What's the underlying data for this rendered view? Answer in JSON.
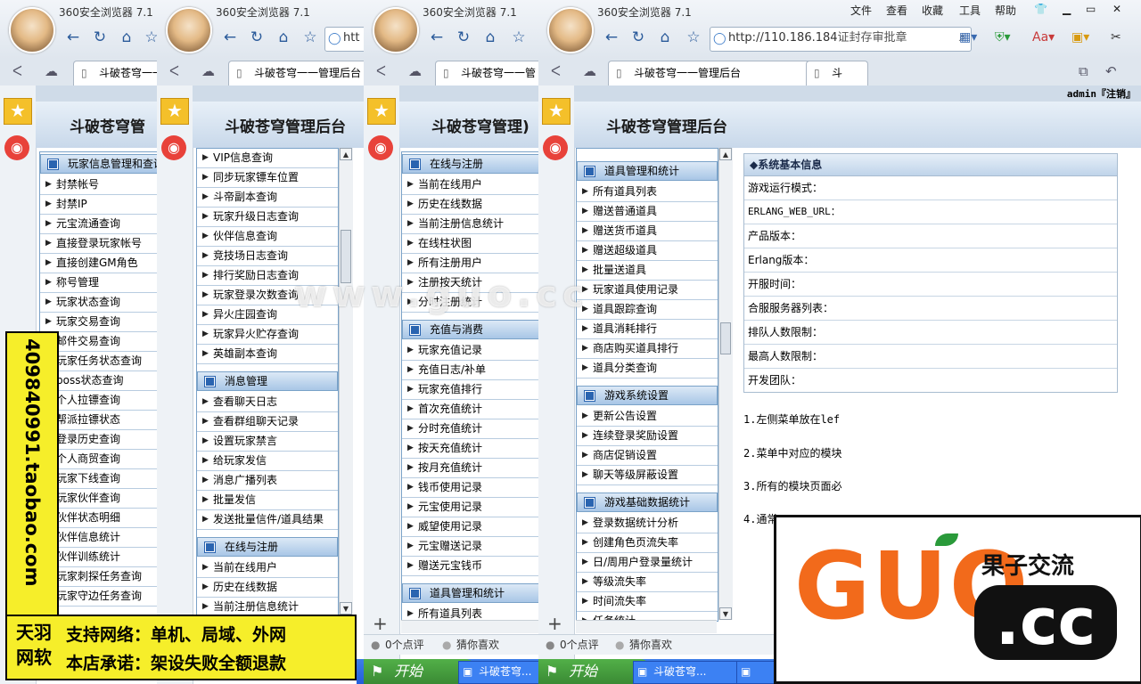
{
  "browser": {
    "title": "360安全浏览器 7.1",
    "url_partial_1": "htt",
    "url_full": "http://110.186.184",
    "url_extra": "证封存审批章",
    "tab_label_short": "斗破苍穹一一",
    "tab_label_mid": "斗破苍穹一一管理后台",
    "tab_label_full": "斗破苍穹一一管理后台",
    "tab_label_cut": "斗破苍穹一一管",
    "tab_next": "斗",
    "menubar": [
      "文件",
      "查看",
      "收藏",
      "工具",
      "帮助"
    ],
    "status_comments": "0个点评",
    "status_guess": "猜你喜欢",
    "close_x": "×",
    "new_tab_plus": "+"
  },
  "page": {
    "admin_bar": "admin『注销』",
    "banner_title": "斗破苍穹管理后台",
    "banner_title_cut1": "斗破苍穹管",
    "banner_title_cut2": "斗破苍穹管理后台",
    "banner_title_cut3": "斗破苍穹管理)"
  },
  "menu_win1": {
    "head": "玩家信息管理和查询",
    "items": [
      "封禁帐号",
      "封禁IP",
      "元宝流通查询",
      "直接登录玩家帐号",
      "直接创建GM角色",
      "称号管理",
      "玩家状态查询",
      "玩家交易查询",
      "邮件交易查询",
      "玩家任务状态查询",
      "boss状态查询",
      "个人拉镖查询",
      "帮派拉镖状态",
      "登录历史查询",
      "个人商贸查询",
      "玩家下线查询",
      "玩家伙伴查询",
      "伙伴状态明细",
      "伙伴信息统计",
      "伙伴训练统计",
      "玩家刺探任务查询",
      "玩家守边任务查询"
    ]
  },
  "menu_win2": {
    "items_top": [
      "VIP信息查询",
      "同步玩家镖车位置",
      "斗帝副本查询",
      "玩家升级日志查询",
      "伙伴信息查询",
      "竞技场日志查询",
      "排行奖励日志查询",
      "玩家登录次数查询",
      "异火庄园查询",
      "玩家异火贮存查询",
      "英雄副本查询"
    ],
    "head_msg": "消息管理",
    "items_msg": [
      "查看聊天日志",
      "查看群组聊天记录",
      "设置玩家禁言",
      "给玩家发信",
      "消息广播列表",
      "批量发信",
      "发送批量信件/道具结果"
    ],
    "head_online": "在线与注册",
    "items_online": [
      "当前在线用户",
      "历史在线数据",
      "当前注册信息统计"
    ]
  },
  "menu_win3": {
    "head_online": "在线与注册",
    "items_online": [
      "当前在线用户",
      "历史在线数据",
      "当前注册信息统计",
      "在线柱状图",
      "所有注册用户",
      "注册按天统计",
      "分时注册统计"
    ],
    "head_pay": "充值与消费",
    "items_pay": [
      "玩家充值记录",
      "充值日志/补单",
      "玩家充值排行",
      "首次充值统计",
      "分时充值统计",
      "按天充值统计",
      "按月充值统计",
      "钱币使用记录",
      "元宝使用记录",
      "威望使用记录",
      "元宝赠送记录",
      "赠送元宝钱币"
    ],
    "head_items": "道具管理和统计",
    "items_items": [
      "所有道具列表"
    ]
  },
  "menu_win4": {
    "head_items": "道具管理和统计",
    "items_items": [
      "所有道具列表",
      "赠送普通道具",
      "赠送货币道具",
      "赠送超级道具",
      "批量送道具",
      "玩家道具使用记录",
      "道具跟踪查询",
      "道具消耗排行",
      "商店购买道具排行",
      "道具分类查询"
    ],
    "head_sys": "游戏系统设置",
    "items_sys": [
      "更新公告设置",
      "连续登录奖励设置",
      "商店促销设置",
      "聊天等级屏蔽设置"
    ],
    "head_stats": "游戏基础数据统计",
    "items_stats": [
      "登录数据统计分析",
      "创建角色页流失率",
      "日/周用户登录量统计",
      "等级流失率",
      "时间流失率",
      "任务统计"
    ]
  },
  "sysinfo": {
    "title": "◆系统基本信息",
    "rows": [
      "游戏运行模式：",
      "ERLANG_WEB_URL：",
      "产品版本：",
      "Erlang版本：",
      "开服时间：",
      "合服服务器列表：",
      "排队人数限制：",
      "最高人数限制：",
      "开发团队："
    ],
    "notes": [
      "1.左侧菜单放在lef",
      "2.菜单中对应的模块",
      "3.所有的模块页面必",
      "4.通常"
    ]
  },
  "taskbar": {
    "start": "开始",
    "item1": "斗破苍穹...",
    "item2": "斗破苍穹..."
  },
  "ads": {
    "vertical": "409840991.taobao.com",
    "logo_top": "天羽",
    "logo_bottom": "网软",
    "line1": "支持网络：单机、局域、外网",
    "line2": "本店承诺：架设失败全额退款",
    "watermark": "www.guo.cc",
    "guo_big": "GUO",
    "guo_cc": ".cc",
    "guo_cn": "果子交流"
  },
  "colors": {
    "accent": "#2a64b0",
    "window_divider": "#c82828",
    "ad_yellow": "#f6ee2a",
    "guo_orange": "#f26a1b"
  }
}
